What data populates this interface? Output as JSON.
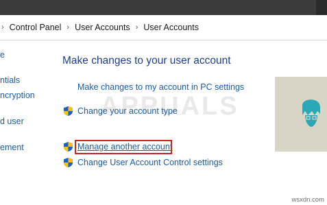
{
  "breadcrumb": [
    "Control Panel",
    "User Accounts",
    "User Accounts"
  ],
  "left_nav": [
    "e",
    "ntials",
    "ncryption",
    "d user",
    "ement"
  ],
  "main": {
    "heading": "Make changes to your user account",
    "tasks": [
      {
        "label": "Make changes to my account in PC settings",
        "shield": false
      },
      {
        "label": "Change your account type",
        "shield": true
      },
      {
        "label": "Manage another account",
        "shield": true
      },
      {
        "label": "Change User Account Control settings",
        "shield": true
      }
    ]
  },
  "watermark": "APPUALS",
  "footer": "wsxdn.com",
  "colors": {
    "link": "#1e5aa8",
    "heading": "#1e3d8f",
    "highlight": "#d21f1f",
    "titlebar": "#3b3b3b",
    "avatar_bg": "#d9d5c6",
    "avatar_fg": "#2aa8b8"
  }
}
